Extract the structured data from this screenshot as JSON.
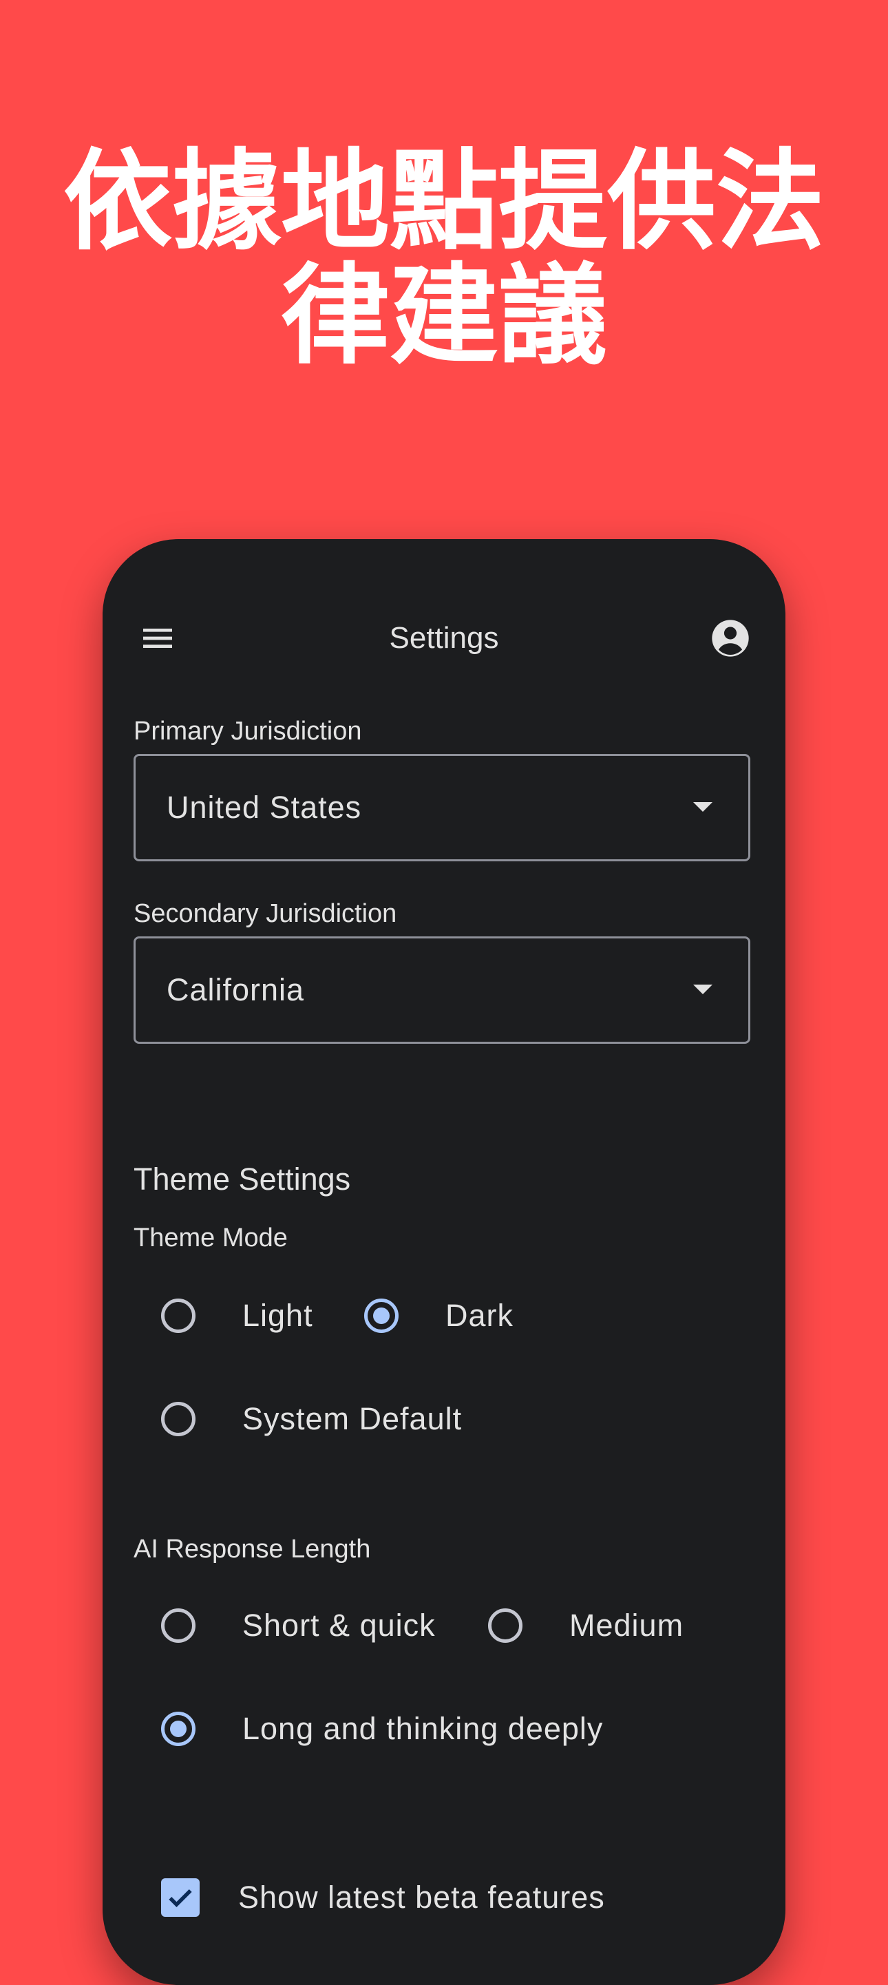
{
  "headline": {
    "line1": "依據地點提供法",
    "line2": "律建議"
  },
  "appbar": {
    "title": "Settings",
    "menu_icon": "menu-icon",
    "account_icon": "account-circle-icon"
  },
  "jurisdiction": {
    "primary_label": "Primary Jurisdiction",
    "primary_value": "United States",
    "secondary_label": "Secondary Jurisdiction",
    "secondary_value": "California"
  },
  "theme": {
    "section_title": "Theme Settings",
    "mode_label": "Theme Mode",
    "options": [
      {
        "label": "Light",
        "selected": false
      },
      {
        "label": "Dark",
        "selected": true
      },
      {
        "label": "System Default",
        "selected": false
      }
    ]
  },
  "ai_response": {
    "label": "AI Response Length",
    "options": [
      {
        "label": "Short & quick",
        "selected": false
      },
      {
        "label": "Medium",
        "selected": false
      },
      {
        "label": "Long and thinking deeply",
        "selected": true
      }
    ]
  },
  "beta": {
    "label": "Show latest beta features",
    "checked": true
  },
  "colors": {
    "background": "#FF4A4A",
    "surface": "#1C1D1F",
    "accent": "#A8C7FA",
    "text": "#E3E3E3"
  }
}
